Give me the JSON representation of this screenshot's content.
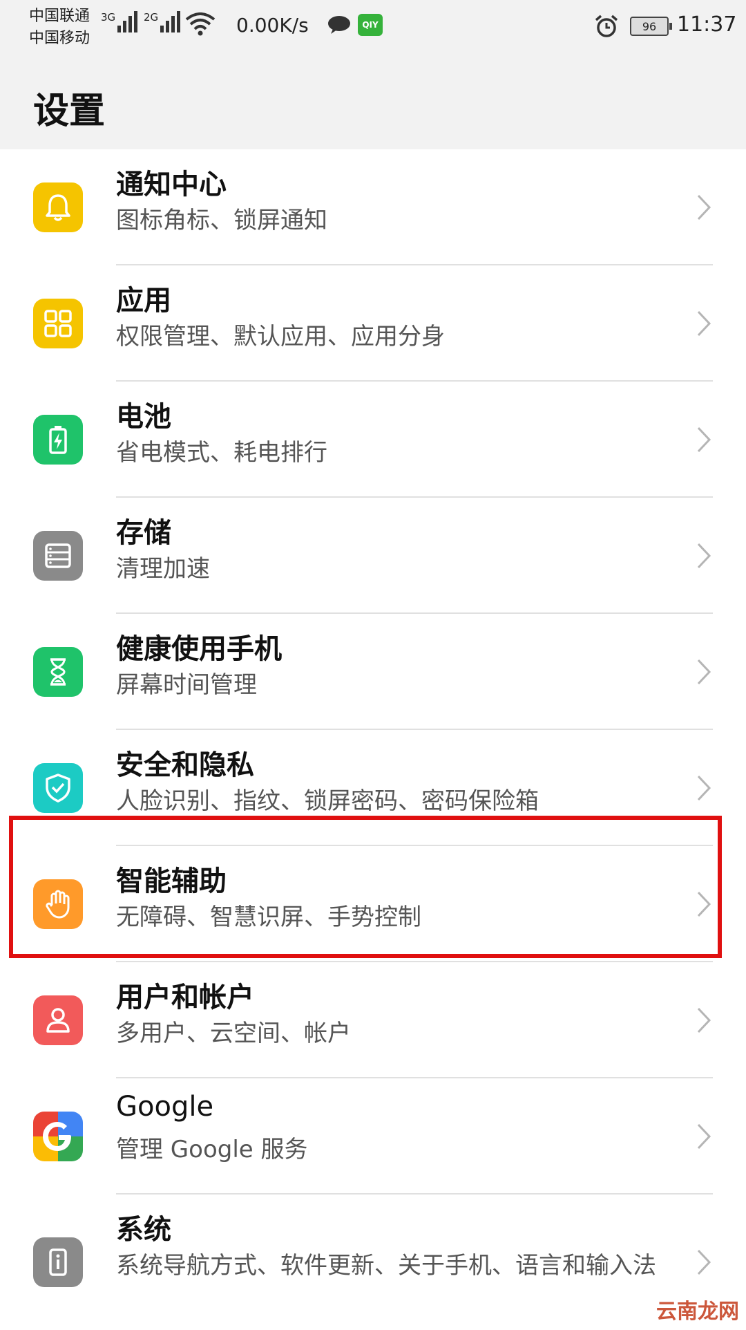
{
  "status_bar": {
    "carrier1": "中国联通",
    "carrier2": "中国移动",
    "sim1_tag": "3G",
    "sim2_tag": "2G",
    "net_speed": "0.00K/s",
    "app_badge": "QIY",
    "battery": "96",
    "time": "11:37"
  },
  "header": {
    "title": "设置"
  },
  "items": [
    {
      "title": "通知中心",
      "subtitle": "图标角标、锁屏通知",
      "icon": "bell-icon",
      "color": "#f5c400"
    },
    {
      "title": "应用",
      "subtitle": "权限管理、默认应用、应用分身",
      "icon": "apps-grid-icon",
      "color": "#f5c400"
    },
    {
      "title": "电池",
      "subtitle": "省电模式、耗电排行",
      "icon": "battery-icon",
      "color": "#1fc36a"
    },
    {
      "title": "存储",
      "subtitle": "清理加速",
      "icon": "storage-icon",
      "color": "#8a8a8a"
    },
    {
      "title": "健康使用手机",
      "subtitle": "屏幕时间管理",
      "icon": "hourglass-icon",
      "color": "#1fc36a"
    },
    {
      "title": "安全和隐私",
      "subtitle": "人脸识别、指纹、锁屏密码、密码保险箱",
      "icon": "shield-icon",
      "color": "#1ccbc4"
    },
    {
      "title": "智能辅助",
      "subtitle": "无障碍、智慧识屏、手势控制",
      "icon": "hand-icon",
      "color": "#ff9a2a"
    },
    {
      "title": "用户和帐户",
      "subtitle": "多用户、云空间、帐户",
      "icon": "user-icon",
      "color": "#f25a5a"
    },
    {
      "title": "Google",
      "subtitle": "管理 Google 服务",
      "icon": "google-icon",
      "color": "#ffffff"
    },
    {
      "title": "系统",
      "subtitle": "系统导航方式、软件更新、关于手机、语言和输入法",
      "icon": "phone-info-icon",
      "color": "#8a8a8a"
    }
  ],
  "watermark": "云南龙网"
}
